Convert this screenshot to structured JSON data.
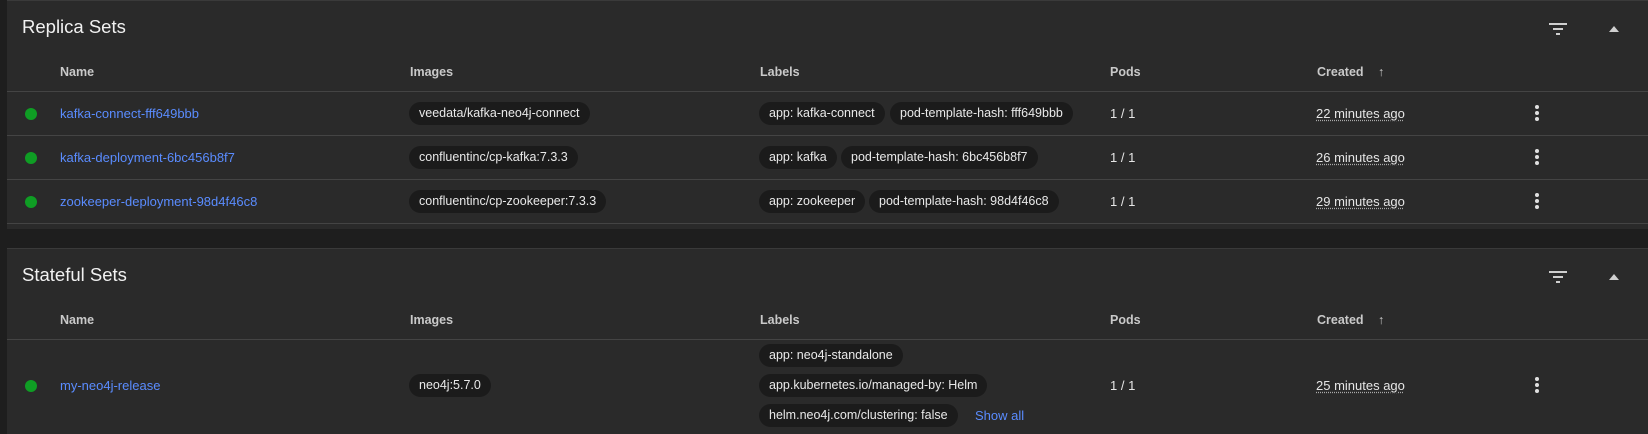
{
  "replica_sets": {
    "title": "Replica Sets",
    "columns": {
      "name": "Name",
      "images": "Images",
      "labels": "Labels",
      "pods": "Pods",
      "created": "Created"
    },
    "sort_arrow": "↑",
    "rows": [
      {
        "name": "kafka-connect-fff649bbb",
        "image": "veedata/kafka-neo4j-connect",
        "labels": [
          "app: kafka-connect",
          "pod-template-hash: fff649bbb"
        ],
        "pods": "1 / 1",
        "created": "22 minutes ago"
      },
      {
        "name": "kafka-deployment-6bc456b8f7",
        "image": "confluentinc/cp-kafka:7.3.3",
        "labels": [
          "app: kafka",
          "pod-template-hash: 6bc456b8f7"
        ],
        "pods": "1 / 1",
        "created": "26 minutes ago"
      },
      {
        "name": "zookeeper-deployment-98d4f46c8",
        "image": "confluentinc/cp-zookeeper:7.3.3",
        "labels": [
          "app: zookeeper",
          "pod-template-hash: 98d4f46c8"
        ],
        "pods": "1 / 1",
        "created": "29 minutes ago"
      }
    ]
  },
  "stateful_sets": {
    "title": "Stateful Sets",
    "columns": {
      "name": "Name",
      "images": "Images",
      "labels": "Labels",
      "pods": "Pods",
      "created": "Created"
    },
    "sort_arrow": "↑",
    "rows": [
      {
        "name": "my-neo4j-release",
        "image": "neo4j:5.7.0",
        "labels": [
          "app: neo4j-standalone",
          "app.kubernetes.io/managed-by: Helm",
          "helm.neo4j.com/clustering: false"
        ],
        "show_all": "Show all",
        "pods": "1 / 1",
        "created": "25 minutes ago"
      }
    ]
  },
  "colors": {
    "status_running": "#0f9d24",
    "link": "#5a8cff",
    "card_bg": "#2a2a2a",
    "page_bg": "#1e1e1e"
  },
  "icons": {
    "filter": "filter-icon",
    "collapse": "chevron-up-icon",
    "row_menu": "more-vert-icon"
  }
}
